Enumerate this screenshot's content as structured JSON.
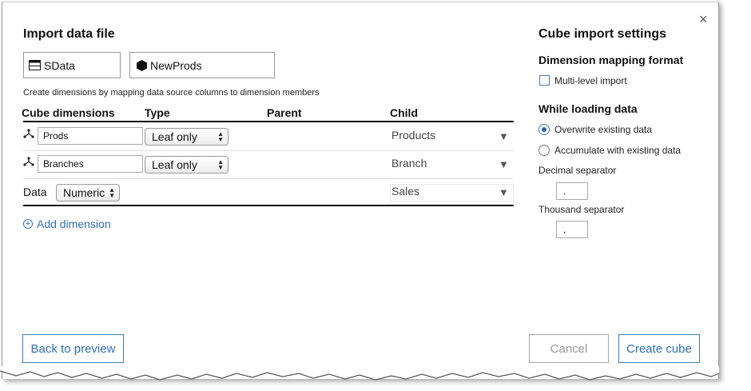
{
  "dialog": {
    "close_glyph": "×"
  },
  "left": {
    "title": "Import data file",
    "source_file": "SData",
    "cube_name": "NewProds",
    "hint": "Create dimensions by mapping data source columns to dimension members",
    "headers": {
      "cube_dimensions": "Cube dimensions",
      "type": "Type",
      "parent": "Parent",
      "child": "Child"
    },
    "rows": [
      {
        "name": "Prods",
        "type": "Leaf only",
        "child": "Products"
      },
      {
        "name": "Branches",
        "type": "Leaf only",
        "child": "Branch"
      }
    ],
    "data_row": {
      "label": "Data",
      "type": "Numeric",
      "child": "Sales"
    },
    "add_dimension": "Add dimension",
    "add_icon": "+"
  },
  "right": {
    "title": "Cube import settings",
    "mapping_heading": "Dimension mapping format",
    "multilevel_label": "Multi-level import",
    "loading_heading": "While loading data",
    "overwrite_label": "Overwrite existing data",
    "accumulate_label": "Accumulate with existing data",
    "decimal_label": "Decimal separator",
    "decimal_value": ".",
    "thousand_label": "Thousand separator",
    "thousand_value": ","
  },
  "footer": {
    "back": "Back to preview",
    "cancel": "Cancel",
    "create": "Create cube"
  },
  "icons": {
    "table": "table-icon",
    "cube": "cube-icon",
    "dimension": "hierarchy-icon",
    "dropdown": "triangle-down-icon",
    "close": "close-icon"
  },
  "colors": {
    "accent": "#2f6fb5",
    "disabled": "#999999"
  }
}
